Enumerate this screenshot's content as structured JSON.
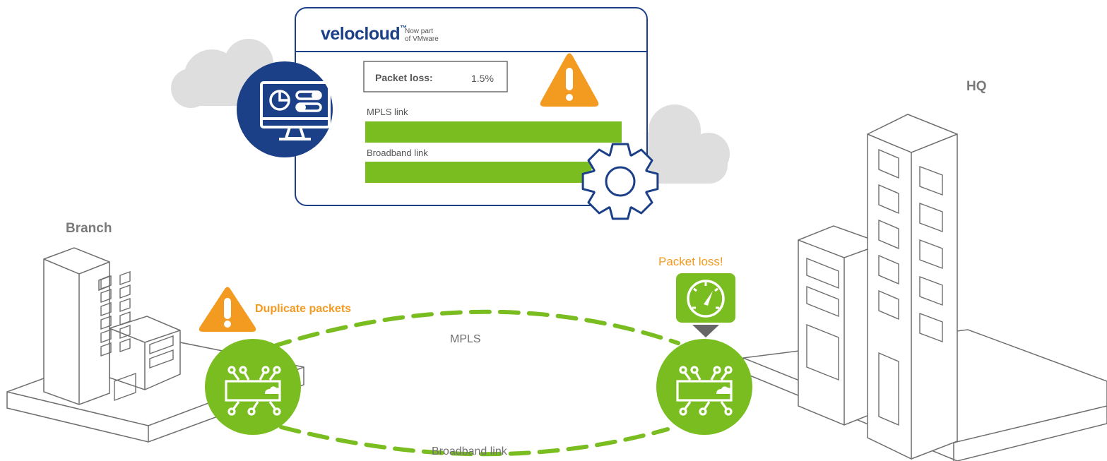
{
  "dashboard": {
    "brand_word": "velocloud",
    "brand_tm": "™",
    "brand_tag_line1": "Now part",
    "brand_tag_line2": "of VMware",
    "metric_label": "Packet loss:",
    "metric_value": "1.5%",
    "links": [
      {
        "label": "MPLS link"
      },
      {
        "label": "Broadband link"
      }
    ]
  },
  "sites": {
    "branch": "Branch",
    "hq": "HQ"
  },
  "annotations": {
    "duplicate_packets": "Duplicate packets",
    "packet_loss_alert": "Packet loss!"
  },
  "connections": {
    "top": "MPLS",
    "bottom": "Broadband link"
  },
  "colors": {
    "navy": "#1b4088",
    "green": "#7abd20",
    "orange": "#f39a21",
    "cloud": "#dedede",
    "outline": "#6e6e6e"
  }
}
